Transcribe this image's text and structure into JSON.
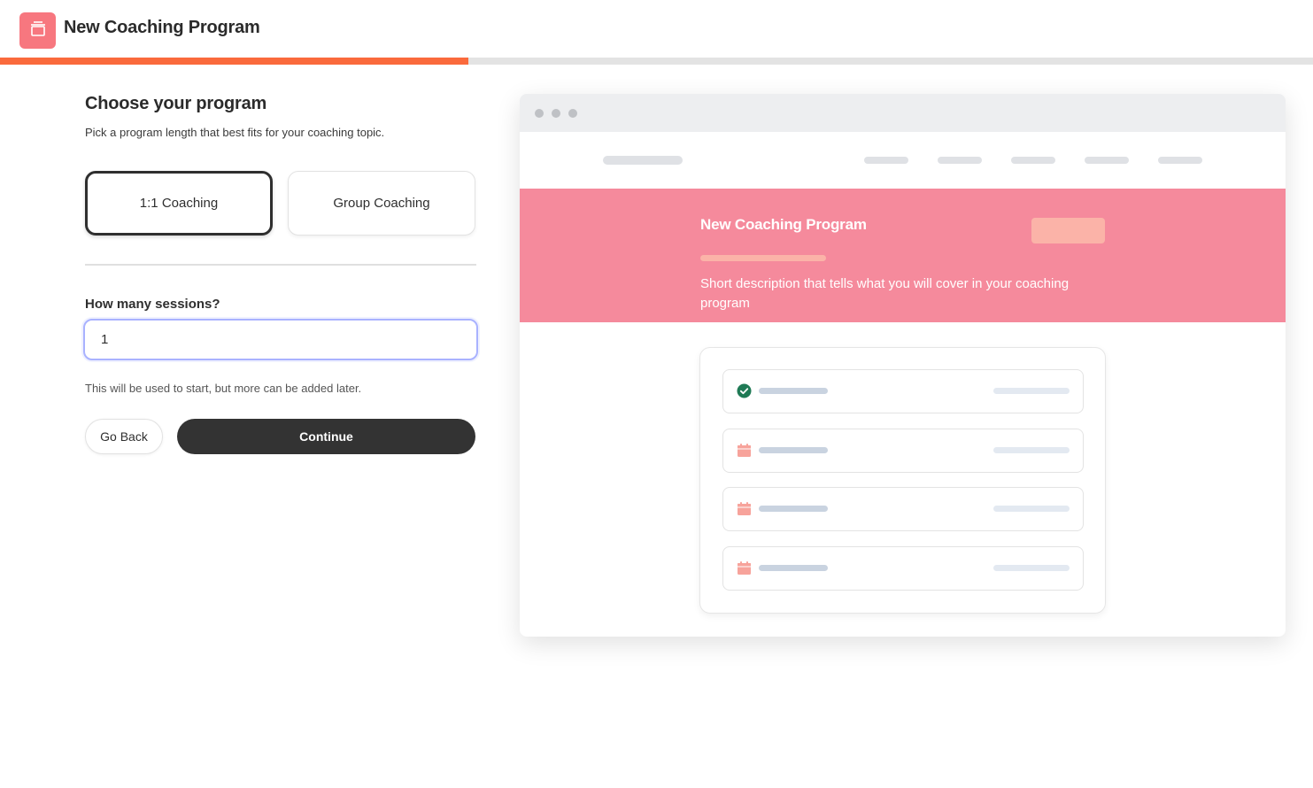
{
  "app": {
    "title": "New Coaching Program",
    "icon": "archive-box-icon",
    "accent_color": "#fa6a3c",
    "icon_bg_color": "#f7777f",
    "progress": 0.357
  },
  "form": {
    "title": "Choose your program",
    "subtitle": "Pick a program length that best fits for your coaching topic.",
    "options": [
      {
        "label": "1:1 Coaching",
        "selected": true
      },
      {
        "label": "Group Coaching",
        "selected": false
      }
    ],
    "sessions_label": "How many sessions?",
    "sessions_value": "1",
    "hint": "This will be used to start, but more can be added later.",
    "back_label": "Go Back",
    "continue_label": "Continue"
  },
  "preview": {
    "hero_title": "New Coaching Program",
    "hero_description": "Short description that tells what you will cover in your coaching program",
    "hero_color": "#f58a9c",
    "hero_accent_color": "#fbb3a8",
    "placeholder_bar_color": "#dfe1e5",
    "row_bar_color": "#c9d3e0",
    "row_bar_light_color": "#e3e9f1",
    "rows": [
      {
        "icon": "check-circle-icon",
        "status": "done"
      },
      {
        "icon": "calendar-icon",
        "status": "scheduled"
      },
      {
        "icon": "calendar-icon",
        "status": "scheduled"
      },
      {
        "icon": "calendar-icon",
        "status": "scheduled"
      }
    ],
    "check_color": "#1f7a55",
    "calendar_color": "#f7a39b"
  }
}
